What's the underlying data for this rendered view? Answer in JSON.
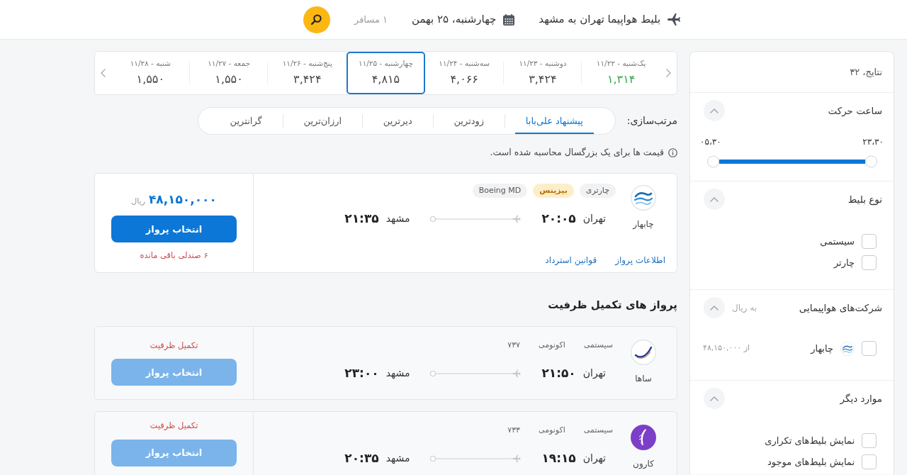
{
  "header": {
    "route": "بلیط هواپیما تهران به مشهد",
    "date": "چهارشنبه، ۲۵ بهمن",
    "passengers": "۱ مسافر"
  },
  "filters": {
    "results": "نتایج، ۳۲",
    "sections": [
      {
        "kind": "range",
        "title": "ساعت حرکت",
        "expanded": true,
        "labels": [
          "۲۳،۳۰",
          "۰۵،۳۰"
        ],
        "thumbs": [
          {
            "level": 0
          },
          {
            "level": 1
          }
        ]
      },
      {
        "kind": "checks",
        "title": "نوع بلیط",
        "expanded": true,
        "options": [
          {
            "label": "سیستمی",
            "checked": false
          },
          {
            "label": "چارتر",
            "checked": false
          }
        ]
      },
      {
        "kind": "airlines",
        "title": "شرکت‌های هواپیمایی",
        "note": "به ریال",
        "expanded": true,
        "airlines": [
          {
            "name": "چابهار",
            "logo": {
              "kind": "waves"
            },
            "price": "از ۴۸,۱۵۰,۰۰۰",
            "checked": false
          }
        ]
      },
      {
        "kind": "checks",
        "title": "موارد دیگر",
        "expanded": true,
        "options": [
          {
            "label": "نمایش بلیط‌های تکراری",
            "checked": false
          },
          {
            "label": "نمایش بلیط‌های موجود",
            "checked": false
          }
        ]
      }
    ]
  },
  "dates": {
    "days": [
      {
        "label": "یک‌شنبه - ۱۱/۲۲",
        "price": "۱,۳۱۴",
        "cheapest": true,
        "selected": false
      },
      {
        "label": "دوشنبه - ۱۱/۲۳",
        "price": "۳,۴۲۴",
        "cheapest": false,
        "selected": false
      },
      {
        "label": "سه‌شنبه - ۱۱/۲۴",
        "price": "۴,۰۶۶",
        "cheapest": false,
        "selected": false
      },
      {
        "label": "چهارشنبه - ۱۱/۲۵",
        "price": "۴,۸۱۵",
        "cheapest": false,
        "selected": true
      },
      {
        "label": "پنج‌شنبه - ۱۱/۲۶",
        "price": "۳,۴۲۴",
        "cheapest": false,
        "selected": false
      },
      {
        "label": "جمعه - ۱۱/۲۷",
        "price": "۱,۵۵۰",
        "cheapest": false,
        "selected": false
      },
      {
        "label": "شنبه - ۱۱/۲۸",
        "price": "۱,۵۵۰",
        "cheapest": false,
        "selected": false
      }
    ]
  },
  "sort": {
    "label": "مرتب‌سازی:",
    "options": [
      {
        "label": "پیشنهاد علی‌بابا",
        "selected": true
      },
      {
        "label": "زودترین",
        "selected": false
      },
      {
        "label": "دیرترین",
        "selected": false
      },
      {
        "label": "ارزان‌ترین",
        "selected": false
      },
      {
        "label": "گرانترین",
        "selected": false
      }
    ]
  },
  "notice": "قیمت ها برای یک بزرگسال محاسبه شده است.",
  "flights": [
    {
      "airline": "چابهار",
      "logo": {
        "kind": "waves"
      },
      "sold_out": false,
      "tags": [
        {
          "label": "چارتری",
          "kind": "plain"
        },
        {
          "label": "بیزینس",
          "kind": "highlight"
        },
        {
          "label": "Boeing MD",
          "kind": "plain"
        }
      ],
      "origin": "تهران",
      "departure": "۲۰:۰۵",
      "destination": "مشهد",
      "arrival": "۲۱:۳۵",
      "links": [
        "اطلاعات پرواز",
        "قوانین استرداد"
      ],
      "price": "۴۸,۱۵۰,۰۰۰",
      "currency": "ریال",
      "button": "انتخاب پرواز",
      "status": "۶ صندلی باقی مانده"
    }
  ],
  "full_section": {
    "title": "پرواز های تکمیل ظرفیت",
    "flights": [
      {
        "airline": "ساها",
        "logo": {
          "kind": "swoosh"
        },
        "sold_out": true,
        "tags": [
          {
            "label": "سیستمی",
            "kind": "plain"
          },
          {
            "label": "اکونومی",
            "kind": "plain"
          },
          {
            "label": "۷۳۷",
            "kind": "plain"
          }
        ],
        "origin": "تهران",
        "departure": "۲۱:۵۰",
        "destination": "مشهد",
        "arrival": "۲۳:۰۰",
        "button": "انتخاب پرواز",
        "status": "تکمیل ظرفیت"
      },
      {
        "airline": "کارون",
        "logo": {
          "kind": "feather"
        },
        "sold_out": true,
        "tags": [
          {
            "label": "سیستمی",
            "kind": "plain"
          },
          {
            "label": "اکونومی",
            "kind": "plain"
          },
          {
            "label": "۷۳۳",
            "kind": "plain"
          }
        ],
        "origin": "تهران",
        "departure": "۱۹:۱۵",
        "destination": "مشهد",
        "arrival": "۲۰:۳۵",
        "button": "انتخاب پرواز",
        "status": "تکمیل ظرفیت"
      }
    ]
  }
}
